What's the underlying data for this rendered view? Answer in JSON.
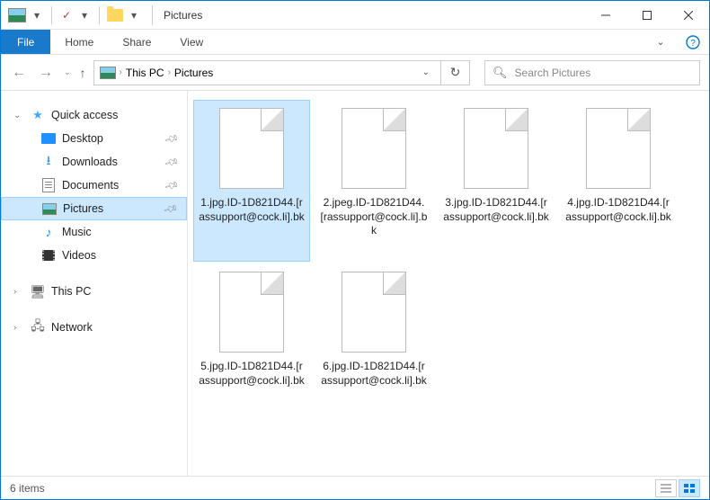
{
  "window": {
    "title": "Pictures"
  },
  "ribbon": {
    "file": "File",
    "tabs": [
      "Home",
      "Share",
      "View"
    ]
  },
  "address": {
    "root": "This PC",
    "folder": "Pictures"
  },
  "search": {
    "placeholder": "Search Pictures"
  },
  "sidebar": {
    "quick_access": "Quick access",
    "items": [
      {
        "label": "Desktop",
        "pinned": true
      },
      {
        "label": "Downloads",
        "pinned": true
      },
      {
        "label": "Documents",
        "pinned": true
      },
      {
        "label": "Pictures",
        "pinned": true,
        "selected": true
      },
      {
        "label": "Music",
        "pinned": false
      },
      {
        "label": "Videos",
        "pinned": false
      }
    ],
    "this_pc": "This PC",
    "network": "Network"
  },
  "files": [
    {
      "name": "1.jpg.ID-1D821D44.[rassupport@cock.li].bk",
      "selected": true
    },
    {
      "name": "2.jpeg.ID-1D821D44.[rassupport@cock.li].bk",
      "selected": false
    },
    {
      "name": "3.jpg.ID-1D821D44.[rassupport@cock.li].bk",
      "selected": false
    },
    {
      "name": "4.jpg.ID-1D821D44.[rassupport@cock.li].bk",
      "selected": false
    },
    {
      "name": "5.jpg.ID-1D821D44.[rassupport@cock.li].bk",
      "selected": false
    },
    {
      "name": "6.jpg.ID-1D821D44.[rassupport@cock.li].bk",
      "selected": false
    }
  ],
  "status": {
    "text": "6 items"
  }
}
